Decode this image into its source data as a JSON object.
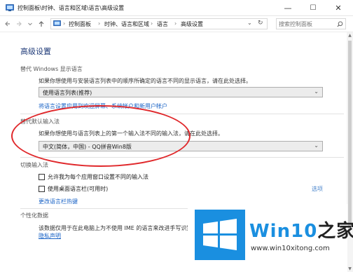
{
  "window": {
    "title": "控制面板\\时钟、语言和区域\\语言\\高级设置",
    "minimize_glyph": "—",
    "maximize_glyph": "☐",
    "close_glyph": "✕"
  },
  "address": {
    "breadcrumbs": [
      "控制面板",
      "时钟、语言和区域",
      "语言",
      "高级设置"
    ],
    "search_placeholder": "搜索控制面板"
  },
  "content": {
    "heading": "高级设置",
    "display_lang": {
      "title": "替代 Windows 显示语言",
      "description": "如果你想使用与安装语言列表中的顺序所确定的语言不同的显示语言，请在此处选择。",
      "selected": "使用语言列表(推荐)",
      "link": "将语言设置应用到欢迎屏幕、系统帐户和新用户帐户"
    },
    "default_input": {
      "title": "替代默认输入法",
      "description": "如果你想使用与语言列表上的第一个输入法不同的输入法，请在此处选择。",
      "selected": "中文(简体，中国) - QQ拼音Win8版"
    },
    "switch_input": {
      "title": "切换输入法",
      "checkbox1": "允许我为每个应用窗口设置不同的输入法",
      "checkbox2": "使用桌面语言栏(可用时)",
      "options_link": "选项",
      "hotkeys_link": "更改语言栏热键"
    },
    "personalization": {
      "title": "个性化数据",
      "description": "该数据仅用于在此电脑上为不使用 IME 的语言来改进手写识别",
      "privacy_link": "隐私声明"
    }
  },
  "watermark": {
    "brand_prefix": "Win10",
    "brand_suffix": "之家",
    "url": "www.win10xitong.com"
  },
  "colors": {
    "accent_link": "#1a63c6",
    "heading": "#1e3a78",
    "highlight": "#e0282b",
    "watermark_blue": "#1a8fe0"
  },
  "icons": [
    "control-panel-icon",
    "back-arrow-icon",
    "forward-arrow-icon",
    "up-arrow-icon",
    "search-icon",
    "chevron-down-icon",
    "refresh-icon",
    "windows-logo-icon"
  ]
}
